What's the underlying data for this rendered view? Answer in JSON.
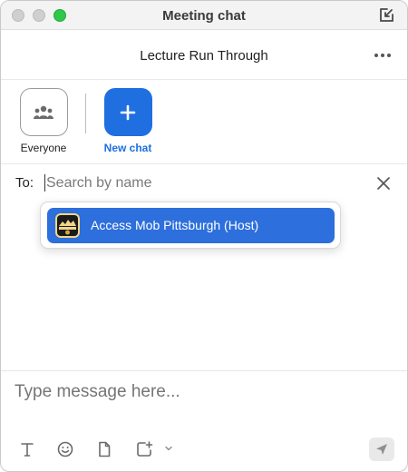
{
  "window": {
    "title": "Meeting chat"
  },
  "header": {
    "meeting_name": "Lecture Run Through"
  },
  "targets": [
    {
      "label": "Everyone",
      "icon": "group-icon"
    },
    {
      "label": "New chat",
      "icon": "plus-icon"
    }
  ],
  "recipient": {
    "to_label": "To:",
    "search_placeholder": "Search by name",
    "search_value": ""
  },
  "dropdown": {
    "options": [
      {
        "label": "Access Mob Pittsburgh (Host)",
        "avatar": "host-avatar",
        "selected": true
      }
    ]
  },
  "composer": {
    "placeholder": "Type message here...",
    "value": "",
    "tools": [
      "text-format-icon",
      "emoji-icon",
      "file-icon",
      "screenshot-icon"
    ]
  },
  "colors": {
    "accent": "#1f6fe0",
    "selection": "#2d6fdc",
    "window_max_button": "#2ec84a"
  }
}
